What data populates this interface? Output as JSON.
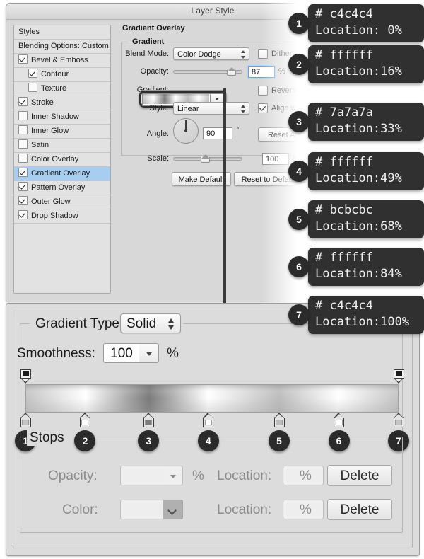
{
  "window": {
    "title": "Layer Style"
  },
  "styles_panel": {
    "header": "Styles",
    "blending_options": "Blending Options: Custom",
    "items": [
      {
        "label": "Bevel & Emboss",
        "checked": true,
        "indent": false,
        "selected": false
      },
      {
        "label": "Contour",
        "checked": true,
        "indent": true,
        "selected": false
      },
      {
        "label": "Texture",
        "checked": false,
        "indent": true,
        "selected": false
      },
      {
        "label": "Stroke",
        "checked": true,
        "indent": false,
        "selected": false
      },
      {
        "label": "Inner Shadow",
        "checked": false,
        "indent": false,
        "selected": false
      },
      {
        "label": "Inner Glow",
        "checked": false,
        "indent": false,
        "selected": false
      },
      {
        "label": "Satin",
        "checked": false,
        "indent": false,
        "selected": false
      },
      {
        "label": "Color Overlay",
        "checked": false,
        "indent": false,
        "selected": false
      },
      {
        "label": "Gradient Overlay",
        "checked": true,
        "indent": false,
        "selected": true
      },
      {
        "label": "Pattern Overlay",
        "checked": true,
        "indent": false,
        "selected": false
      },
      {
        "label": "Outer Glow",
        "checked": true,
        "indent": false,
        "selected": false
      },
      {
        "label": "Drop Shadow",
        "checked": true,
        "indent": false,
        "selected": false
      }
    ]
  },
  "gradient_overlay": {
    "section_title": "Gradient Overlay",
    "group_title": "Gradient",
    "blend_mode_label": "Blend Mode:",
    "blend_mode_value": "Color Dodge",
    "dither_label": "Dither",
    "dither_checked": false,
    "opacity_label": "Opacity:",
    "opacity_value": "87",
    "opacity_unit": "%",
    "gradient_label": "Gradient:",
    "reverse_label": "Reverse",
    "reverse_checked": false,
    "style_label": "Style:",
    "style_value": "Linear",
    "align_label": "Align with Layer",
    "align_checked": true,
    "angle_label": "Angle:",
    "angle_value": "90",
    "angle_unit": "°",
    "reset_alignment_label": "Reset Alignment",
    "scale_label": "Scale:",
    "scale_value": "100",
    "scale_unit": "%",
    "make_default_label": "Make Default",
    "reset_default_label": "Reset to Default"
  },
  "gradient_editor": {
    "type_label": "Gradient Type:",
    "type_value": "Solid",
    "smoothness_label": "Smoothness:",
    "smoothness_value": "100",
    "smoothness_unit": "%",
    "stops_label": "Stops",
    "opacity_label": "Opacity:",
    "opacity_value": "",
    "opacity_unit": "%",
    "color_label": "Color:",
    "location_label_1": "Location:",
    "location_value_1": "",
    "location_unit_1": "%",
    "location_label_2": "Location:",
    "location_value_2": "",
    "location_unit_2": "%",
    "delete_label_1": "Delete",
    "delete_label_2": "Delete"
  },
  "callouts": [
    {
      "num": "1",
      "hex_line": "# c4c4c4",
      "location_line": "Location: 0%",
      "color": "#c4c4c4",
      "location": 0
    },
    {
      "num": "2",
      "hex_line": "# ffffff",
      "location_line": "Location:16%",
      "color": "#ffffff",
      "location": 16
    },
    {
      "num": "3",
      "hex_line": "# 7a7a7a",
      "location_line": "Location:33%",
      "color": "#7a7a7a",
      "location": 33
    },
    {
      "num": "4",
      "hex_line": "# ffffff",
      "location_line": "Location:49%",
      "color": "#ffffff",
      "location": 49
    },
    {
      "num": "5",
      "hex_line": "# bcbcbc",
      "location_line": "Location:68%",
      "color": "#bcbcbc",
      "location": 68
    },
    {
      "num": "6",
      "hex_line": "# ffffff",
      "location_line": "Location:84%",
      "color": "#ffffff",
      "location": 84
    },
    {
      "num": "7",
      "hex_line": "# c4c4c4",
      "location_line": "Location:100%",
      "color": "#c4c4c4",
      "location": 100
    }
  ],
  "stop_numbers": [
    "1",
    "2",
    "3",
    "4",
    "5",
    "6",
    "7"
  ]
}
